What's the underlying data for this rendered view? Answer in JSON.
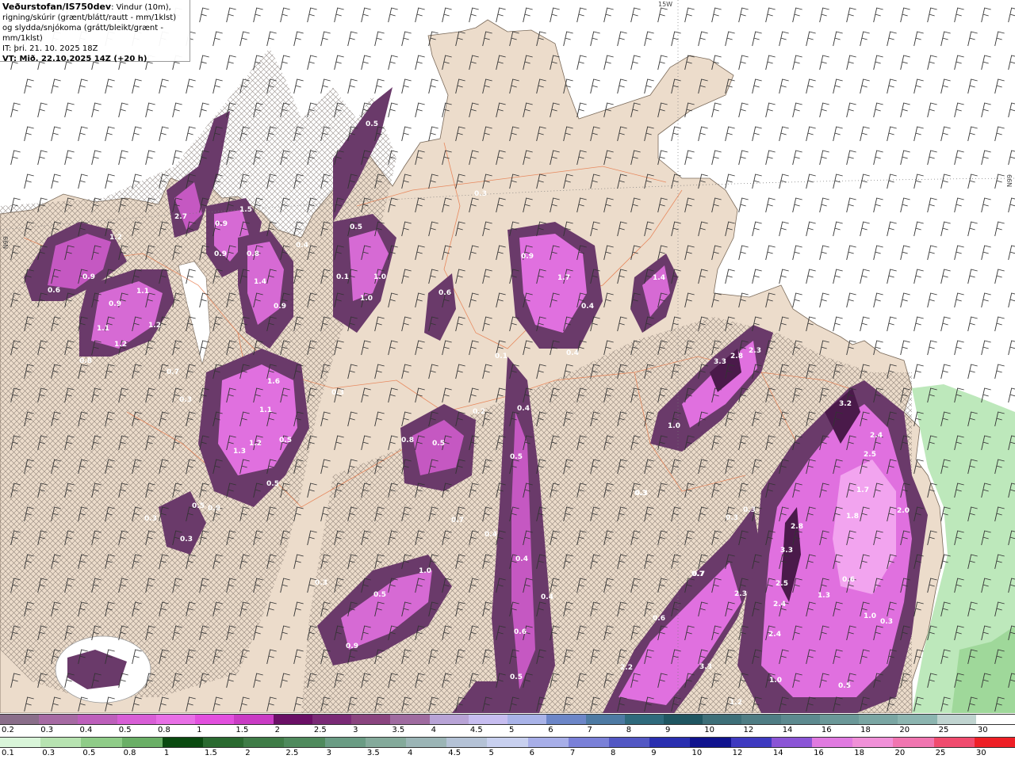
{
  "title": {
    "source": "Veðurstofan/IS750dev",
    "desc": ": Vindur (10m), rigning/skúrir (grænt/blátt/rautt - mm/1klst) og slydda/snjókoma (grátt/bleikt/grænt - mm/1klst)",
    "it": "IT: þri. 21. 10. 2025 18Z",
    "vt": "VT: Mið. 22.10.2025 14Z (+20 h)"
  },
  "axis_labels": {
    "top": "15W",
    "right": "66N",
    "left": "66N"
  },
  "legend_snow": {
    "labels": [
      "0.2",
      "0.3",
      "0.4",
      "0.5",
      "0.8",
      "1",
      "1.5",
      "2",
      "2.5",
      "3",
      "3.5",
      "4",
      "4.5",
      "5",
      "6",
      "7",
      "8",
      "9",
      "10",
      "12",
      "14",
      "16",
      "18",
      "20",
      "25",
      "30"
    ],
    "colors": [
      "#8a6e8a",
      "#a66aa3",
      "#bd5fbb",
      "#d85ed6",
      "#e86fe6",
      "#e24fde",
      "#c93bc4",
      "#6a0f66",
      "#7a2a76",
      "#8a447f",
      "#9f6ba0",
      "#b8a3d6",
      "#c7bdf0",
      "#a9b3e8",
      "#6c86c8",
      "#4d7aa3",
      "#2f6a7c",
      "#1f5661",
      "#3d6f78",
      "#4f7d84",
      "#5d8a8f",
      "#6b9898",
      "#7aa6a3",
      "#8cb5b0",
      "#c0d4d0",
      "#ffffff"
    ]
  },
  "legend_rain": {
    "labels": [
      "0.1",
      "0.3",
      "0.5",
      "0.8",
      "1",
      "1.5",
      "2",
      "2.5",
      "3",
      "3.5",
      "4",
      "4.5",
      "5",
      "6",
      "7",
      "8",
      "9",
      "10",
      "12",
      "14",
      "16",
      "18",
      "20",
      "25",
      "30"
    ],
    "colors": [
      "#d9f5d9",
      "#b7e3b1",
      "#8fcc88",
      "#6aaf66",
      "#0a4a10",
      "#2a6a30",
      "#3f7c47",
      "#4f8a5d",
      "#6a9c84",
      "#84aa9b",
      "#9bb5b6",
      "#b4c2d6",
      "#c8d0ef",
      "#a7aee8",
      "#7a80d8",
      "#5257c4",
      "#2a2fb0",
      "#10138e",
      "#3e3ac0",
      "#8b55d6",
      "#e07ae0",
      "#f090d8",
      "#f075b0",
      "#f04b6e",
      "#ee1f26"
    ]
  },
  "value_labels": [
    {
      "v": "2.7"
    },
    {
      "v": "1.2"
    },
    {
      "v": "0.9"
    },
    {
      "v": "0.6"
    },
    {
      "v": "0.9"
    },
    {
      "v": "1.1"
    },
    {
      "v": "1.1"
    },
    {
      "v": "1.2"
    },
    {
      "v": "1.2"
    },
    {
      "v": "0.8"
    },
    {
      "v": "0.7"
    },
    {
      "v": "0.3"
    },
    {
      "v": "0.9"
    },
    {
      "v": "1.5"
    },
    {
      "v": "0.9"
    },
    {
      "v": "0.8"
    },
    {
      "v": "0.4"
    },
    {
      "v": "1.4"
    },
    {
      "v": "0.9"
    },
    {
      "v": "1.6"
    },
    {
      "v": "1.1"
    },
    {
      "v": "1.3"
    },
    {
      "v": "1.2"
    },
    {
      "v": "0.5"
    },
    {
      "v": "0.5"
    },
    {
      "v": "0.3"
    },
    {
      "v": "0.3"
    },
    {
      "v": "0.5"
    },
    {
      "v": "0.9"
    },
    {
      "v": "0.1"
    },
    {
      "v": "0.5"
    },
    {
      "v": "0.5"
    },
    {
      "v": "1.0"
    },
    {
      "v": "1.0"
    },
    {
      "v": "0.3"
    },
    {
      "v": "0.3"
    },
    {
      "v": "0.6"
    },
    {
      "v": "0.9"
    },
    {
      "v": "1.7"
    },
    {
      "v": "0.4"
    },
    {
      "v": "0.4"
    },
    {
      "v": "1.4"
    },
    {
      "v": "0.1"
    },
    {
      "v": "0.2"
    },
    {
      "v": "0.4"
    },
    {
      "v": "0.8"
    },
    {
      "v": "0.5"
    },
    {
      "v": "0.5"
    },
    {
      "v": "0.7"
    },
    {
      "v": "0.4"
    },
    {
      "v": "0.4"
    },
    {
      "v": "0.4"
    },
    {
      "v": "0.7"
    },
    {
      "v": "0.5"
    },
    {
      "v": "0.6"
    },
    {
      "v": "1.0"
    },
    {
      "v": "0.5"
    },
    {
      "v": "0.9"
    },
    {
      "v": "0.3"
    },
    {
      "v": "0.3"
    },
    {
      "v": "3.3"
    },
    {
      "v": "2.8"
    },
    {
      "v": "2.3"
    },
    {
      "v": "1.0"
    },
    {
      "v": "0.3"
    },
    {
      "v": "0.3"
    },
    {
      "v": "0.3"
    },
    {
      "v": "0.7"
    },
    {
      "v": "0.6"
    },
    {
      "v": "2.2"
    },
    {
      "v": "3.3"
    },
    {
      "v": "2.3"
    },
    {
      "v": "2.8"
    },
    {
      "v": "3.3"
    },
    {
      "v": "2.5"
    },
    {
      "v": "2.4"
    },
    {
      "v": "2.4"
    },
    {
      "v": "1.0"
    },
    {
      "v": "1.3"
    },
    {
      "v": "0.6"
    },
    {
      "v": "1.0"
    },
    {
      "v": "0.5"
    },
    {
      "v": "3.2"
    },
    {
      "v": "2.4"
    },
    {
      "v": "2.5"
    },
    {
      "v": "1.7"
    },
    {
      "v": "1.8"
    },
    {
      "v": "2.0"
    },
    {
      "v": "0.3"
    },
    {
      "v": "1.2"
    }
  ]
}
